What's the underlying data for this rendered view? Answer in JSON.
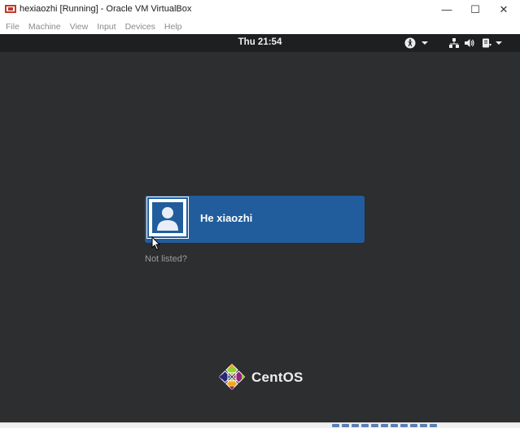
{
  "window": {
    "title": "hexiaozhi  [Running] - Oracle VM VirtualBox",
    "minimize_glyph": "—",
    "maximize_glyph": "☐",
    "close_glyph": "✕"
  },
  "menu": {
    "items": [
      "File",
      "Machine",
      "View",
      "Input",
      "Devices",
      "Help"
    ]
  },
  "gnome": {
    "clock": "Thu 21:54",
    "tray_icons": [
      "accessibility-icon",
      "dropdown-icon",
      "network-icon",
      "volume-icon",
      "power-icon",
      "dropdown-icon"
    ]
  },
  "login": {
    "user_name": "He xiaozhi",
    "not_listed": "Not listed?"
  },
  "branding": {
    "logo_text": "CentOS"
  },
  "colors": {
    "screen_bg": "#2c2e30",
    "topbar_bg": "#1e1f20",
    "selected_user_bg": "#215d9c"
  }
}
